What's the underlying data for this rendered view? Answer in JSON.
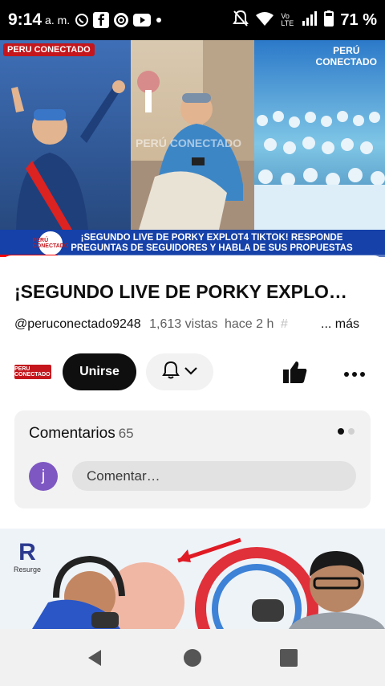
{
  "status_bar": {
    "time": "9:14",
    "ampm": "a. m.",
    "battery": "71 %",
    "network": "Vo LTE",
    "icons": [
      "whatsapp-icon",
      "facebook-icon",
      "radio-icon",
      "youtube-icon",
      "dot-icon",
      "mute-icon",
      "wifi-icon",
      "signal-icon",
      "battery-icon"
    ]
  },
  "video": {
    "logo_left": "PERU CONECTADO",
    "logo_right_line1": "PERÚ",
    "logo_right_line2": "CONECTADO",
    "watermark": "PERÚ CONECTADO",
    "caption_logo": "PERÚ CONECTADO",
    "caption_line1": "¡SEGUNDO LIVE DE PORKY EXPLOT4 TIKTOK! RESPONDE",
    "caption_line2": "PREGUNTAS DE SEGUIDORES Y HABLA DE SUS PROPUESTAS",
    "progress": 0.15,
    "accent": "#ff0000"
  },
  "details": {
    "title": "¡SEGUNDO LIVE DE PORKY EXPLO…",
    "channel": "@peruconectado9248",
    "views": "1,613 vistas",
    "age": "hace 2 h",
    "tag": "#",
    "more": "... más"
  },
  "actions": {
    "channel_logo": "PERU CONECTADO",
    "join_label": "Unirse",
    "bell_icon": "bell-icon",
    "like_icon": "thumbs-up-icon",
    "more_icon": "more-horiz-icon"
  },
  "comments": {
    "title": "Comentarios",
    "count": "65",
    "avatar_initial": "j",
    "placeholder": "Comentar…",
    "avatar_color": "#7e57c2"
  },
  "next_video": {
    "badge": "Resurge",
    "badge_letter": "R"
  },
  "nav_bar": {
    "icons": [
      "back-icon",
      "home-icon",
      "recents-icon"
    ]
  }
}
